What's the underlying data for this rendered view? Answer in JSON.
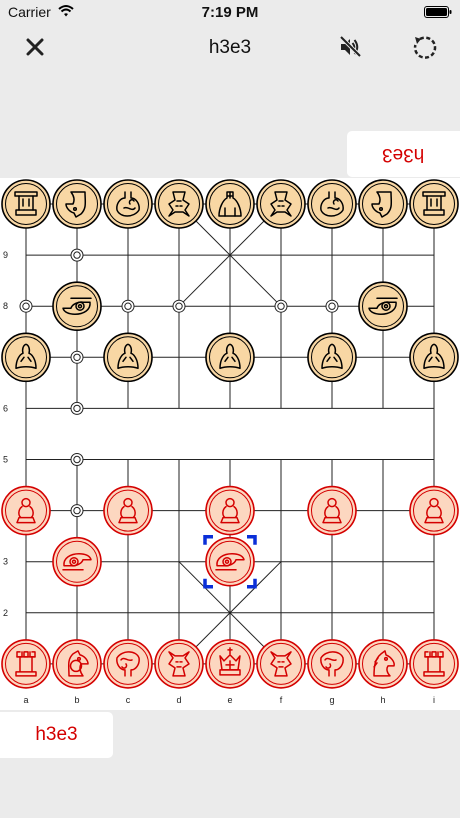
{
  "status": {
    "carrier": "Carrier",
    "time": "7:19 PM"
  },
  "nav": {
    "title": "h3e3"
  },
  "moves": {
    "opponent": "h3e3",
    "mine": "h3e3"
  },
  "colors": {
    "black_face": "#f8d7a4",
    "black_ink": "#000000",
    "red_face": "#fcd7c0",
    "red_ink": "#d40000",
    "selection": "#0a2fd8",
    "board_line": "#222222"
  },
  "board": {
    "files": [
      "a",
      "b",
      "c",
      "d",
      "e",
      "f",
      "g",
      "h",
      "i"
    ],
    "rank_labels": [
      "9",
      "8",
      "6",
      "5",
      "3",
      "2"
    ],
    "hint_points": [
      "b9",
      "a8",
      "c8",
      "d8",
      "f8",
      "g8",
      "b7",
      "b6",
      "b5",
      "b4"
    ],
    "selected_square": "e3",
    "pieces": [
      {
        "side": "black",
        "type": "chariot",
        "square": "a10",
        "icon": "tower-icon"
      },
      {
        "side": "black",
        "type": "horse",
        "square": "b10",
        "icon": "horse-icon"
      },
      {
        "side": "black",
        "type": "elephant",
        "square": "c10",
        "icon": "elephant-icon"
      },
      {
        "side": "black",
        "type": "advisor",
        "square": "d10",
        "icon": "advisor-icon"
      },
      {
        "side": "black",
        "type": "general",
        "square": "e10",
        "icon": "general-icon"
      },
      {
        "side": "black",
        "type": "advisor",
        "square": "f10",
        "icon": "advisor-icon"
      },
      {
        "side": "black",
        "type": "elephant",
        "square": "g10",
        "icon": "elephant-icon"
      },
      {
        "side": "black",
        "type": "horse",
        "square": "h10",
        "icon": "horse-icon"
      },
      {
        "side": "black",
        "type": "chariot",
        "square": "i10",
        "icon": "tower-icon"
      },
      {
        "side": "black",
        "type": "cannon",
        "square": "b8",
        "icon": "cannon-icon"
      },
      {
        "side": "black",
        "type": "cannon",
        "square": "h8",
        "icon": "cannon-icon"
      },
      {
        "side": "black",
        "type": "soldier",
        "square": "a7",
        "icon": "soldier-icon"
      },
      {
        "side": "black",
        "type": "soldier",
        "square": "c7",
        "icon": "soldier-icon"
      },
      {
        "side": "black",
        "type": "soldier",
        "square": "e7",
        "icon": "soldier-icon"
      },
      {
        "side": "black",
        "type": "soldier",
        "square": "g7",
        "icon": "soldier-icon"
      },
      {
        "side": "black",
        "type": "soldier",
        "square": "i7",
        "icon": "soldier-icon"
      },
      {
        "side": "red",
        "type": "soldier",
        "square": "a4",
        "icon": "pawn-icon"
      },
      {
        "side": "red",
        "type": "soldier",
        "square": "c4",
        "icon": "pawn-icon"
      },
      {
        "side": "red",
        "type": "soldier",
        "square": "e4",
        "icon": "pawn-icon"
      },
      {
        "side": "red",
        "type": "soldier",
        "square": "g4",
        "icon": "pawn-icon"
      },
      {
        "side": "red",
        "type": "soldier",
        "square": "i4",
        "icon": "pawn-icon"
      },
      {
        "side": "red",
        "type": "cannon",
        "square": "b3",
        "icon": "cannon-icon"
      },
      {
        "side": "red",
        "type": "cannon",
        "square": "e3",
        "icon": "cannon-icon"
      },
      {
        "side": "red",
        "type": "chariot",
        "square": "a1",
        "icon": "rook-icon"
      },
      {
        "side": "red",
        "type": "horse",
        "square": "b1",
        "icon": "horse-icon"
      },
      {
        "side": "red",
        "type": "elephant",
        "square": "c1",
        "icon": "elephant-icon"
      },
      {
        "side": "red",
        "type": "advisor",
        "square": "d1",
        "icon": "advisor-icon"
      },
      {
        "side": "red",
        "type": "general",
        "square": "e1",
        "icon": "king-icon"
      },
      {
        "side": "red",
        "type": "advisor",
        "square": "f1",
        "icon": "advisor-icon"
      },
      {
        "side": "red",
        "type": "elephant",
        "square": "g1",
        "icon": "elephant-icon"
      },
      {
        "side": "red",
        "type": "horse",
        "square": "h1",
        "icon": "knight-icon"
      },
      {
        "side": "red",
        "type": "chariot",
        "square": "i1",
        "icon": "rook-icon"
      }
    ]
  }
}
